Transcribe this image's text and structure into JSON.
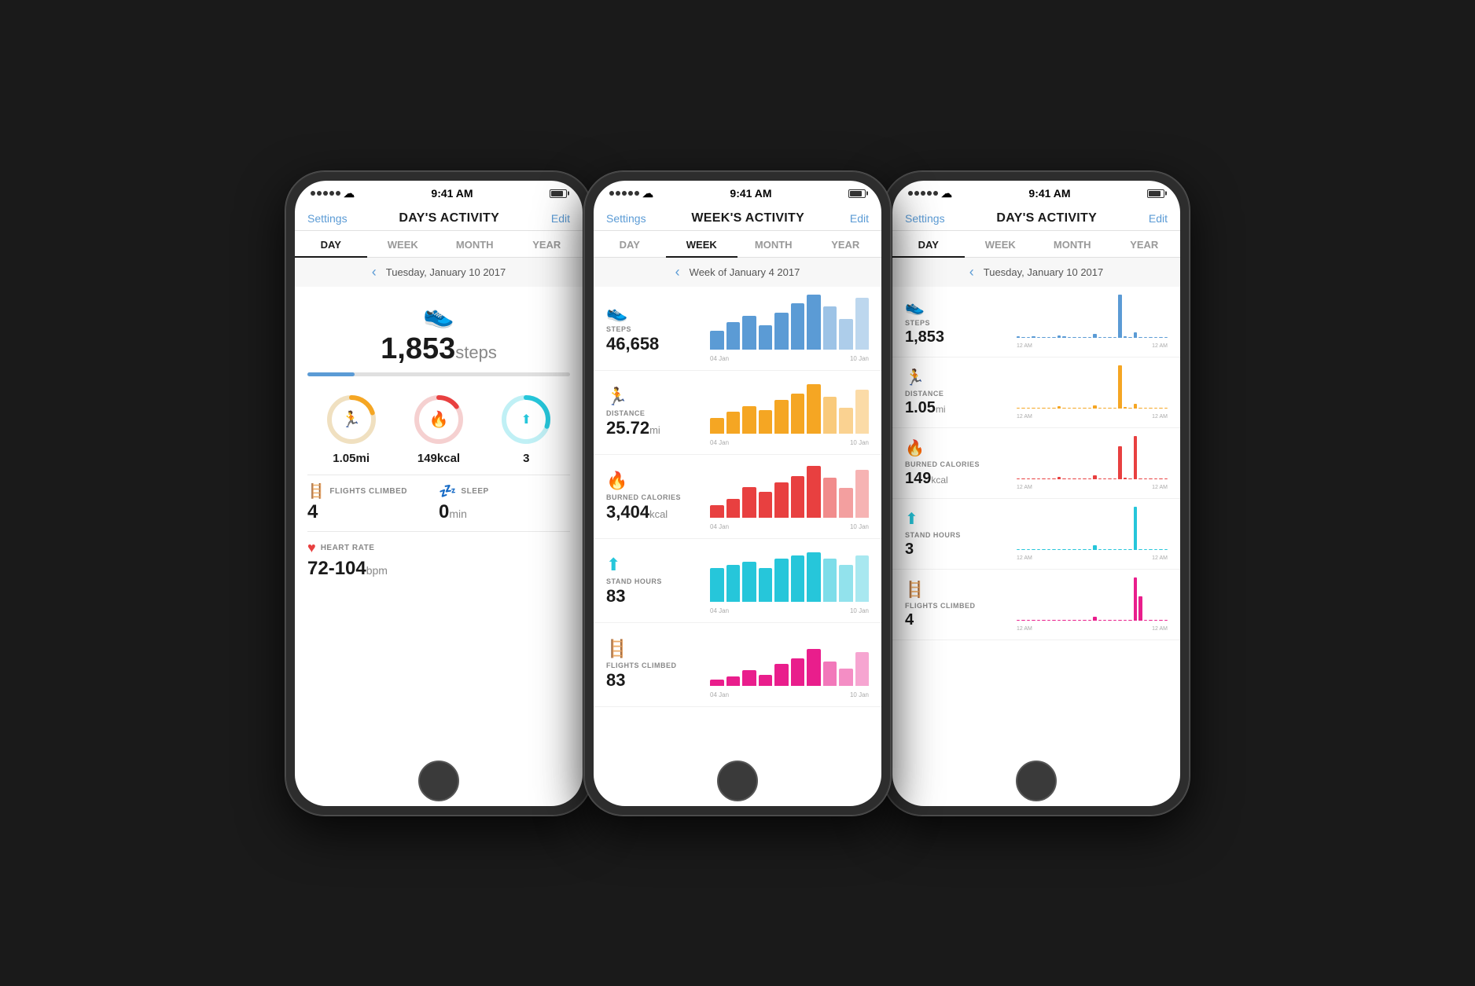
{
  "colors": {
    "blue": "#5b9bd5",
    "orange": "#f5a623",
    "red": "#e84040",
    "teal": "#26c6da",
    "purple": "#9c27b0",
    "pink": "#e91e8c",
    "green": "#4caf50"
  },
  "phone1": {
    "status": {
      "time": "9:41 AM",
      "signal": "●●●●●",
      "wifi": "WiFi"
    },
    "title": "DAY'S ACTIVITY",
    "nav_left": "Settings",
    "nav_right": "Edit",
    "tabs": [
      "DAY",
      "WEEK",
      "MONTH",
      "YEAR"
    ],
    "active_tab": "DAY",
    "date": "Tuesday, January 10 2017",
    "steps": "1,853",
    "steps_label": "steps",
    "progress_pct": 18,
    "rings": [
      {
        "label": "1.05mi",
        "icon": "🏃",
        "color": "#f5a623",
        "pct": 20
      },
      {
        "label": "149kcal",
        "icon": "🔥",
        "color": "#e84040",
        "pct": 15
      },
      {
        "label": "3",
        "icon": "⬆",
        "color": "#26c6da",
        "pct": 30
      }
    ],
    "metrics": [
      {
        "icon_color": "#9c27b0",
        "label": "FLIGHTS CLIMBED",
        "value": "4",
        "unit": ""
      },
      {
        "icon_color": "#5b9bd5",
        "label": "SLEEP",
        "value": "0",
        "unit": "min"
      },
      {
        "icon_color": "#e84040",
        "label": "HEART RATE",
        "value": "72-104",
        "unit": "bpm"
      }
    ]
  },
  "phone2": {
    "status": {
      "time": "9:41 AM"
    },
    "title": "WEEK'S ACTIVITY",
    "nav_left": "Settings",
    "nav_right": "Edit",
    "tabs": [
      "DAY",
      "WEEK",
      "MONTH",
      "YEAR"
    ],
    "active_tab": "WEEK",
    "date": "Week of January 4 2017",
    "date_start": "04 Jan",
    "date_end": "10 Jan",
    "rows": [
      {
        "icon": "👟",
        "label": "STEPS",
        "value": "46,658",
        "unit": "",
        "color": "#5b9bd5",
        "bars": [
          30,
          45,
          55,
          40,
          60,
          75,
          90,
          70,
          50,
          85
        ]
      },
      {
        "icon": "🏃",
        "label": "DISTANCE",
        "value": "25.72",
        "unit": "mi",
        "color": "#f5a623",
        "bars": [
          25,
          35,
          45,
          38,
          55,
          65,
          80,
          60,
          42,
          72
        ]
      },
      {
        "icon": "🔥",
        "label": "BURNED CALORIES",
        "value": "3,404",
        "unit": "kcal",
        "color": "#e84040",
        "bars": [
          20,
          30,
          50,
          42,
          58,
          68,
          85,
          65,
          48,
          78
        ]
      },
      {
        "icon": "⬆",
        "label": "STAND HOURS",
        "value": "83",
        "unit": "",
        "color": "#26c6da",
        "bars": [
          55,
          60,
          65,
          55,
          70,
          75,
          80,
          70,
          60,
          75
        ]
      },
      {
        "icon": "🪜",
        "label": "FLIGHTS CLIMBED",
        "value": "83",
        "unit": "",
        "color": "#e91e8c",
        "bars": [
          10,
          15,
          25,
          18,
          35,
          45,
          60,
          40,
          28,
          55
        ]
      }
    ]
  },
  "phone3": {
    "status": {
      "time": "9:41 AM"
    },
    "title": "DAY'S ACTIVITY",
    "nav_left": "Settings",
    "nav_right": "Edit",
    "tabs": [
      "DAY",
      "WEEK",
      "MONTH",
      "YEAR"
    ],
    "active_tab": "DAY",
    "date": "Tuesday, January 10 2017",
    "time_label_left": "12 AM",
    "time_label_right": "12 AM",
    "rows": [
      {
        "icon": "👟",
        "label": "STEPS",
        "value": "1,853",
        "unit": "",
        "color": "#5b9bd5",
        "bars": [
          0,
          0,
          0,
          0,
          0,
          0,
          0,
          0,
          2,
          0,
          0,
          0,
          0,
          0,
          0,
          4,
          0,
          0,
          0,
          0,
          0,
          0,
          0,
          0,
          0,
          0,
          0,
          80,
          0,
          0,
          0,
          8,
          0,
          0,
          0,
          0,
          0,
          0,
          0,
          0
        ]
      },
      {
        "icon": "🏃",
        "label": "DISTANCE",
        "value": "1.05",
        "unit": "mi",
        "color": "#f5a623",
        "bars": [
          0,
          0,
          0,
          0,
          0,
          0,
          0,
          0,
          1,
          0,
          0,
          0,
          0,
          0,
          0,
          2,
          0,
          0,
          0,
          0,
          0,
          0,
          0,
          0,
          0,
          0,
          0,
          70,
          0,
          0,
          0,
          5,
          0,
          0,
          0,
          0,
          0,
          0,
          0,
          0
        ]
      },
      {
        "icon": "🔥",
        "label": "BURNED CALORIES",
        "value": "149",
        "unit": "kcal",
        "color": "#e84040",
        "bars": [
          0,
          0,
          0,
          0,
          0,
          0,
          0,
          0,
          2,
          0,
          0,
          0,
          0,
          0,
          0,
          3,
          0,
          0,
          0,
          0,
          0,
          0,
          0,
          0,
          0,
          0,
          0,
          60,
          0,
          0,
          0,
          80,
          0,
          0,
          0,
          0,
          0,
          0,
          0,
          0
        ]
      },
      {
        "icon": "⬆",
        "label": "STAND HOURS",
        "value": "3",
        "unit": "",
        "color": "#26c6da",
        "bars": [
          0,
          0,
          0,
          0,
          0,
          0,
          0,
          0,
          0,
          0,
          0,
          0,
          0,
          0,
          0,
          5,
          0,
          0,
          0,
          0,
          0,
          0,
          0,
          0,
          0,
          0,
          0,
          0,
          0,
          0,
          0,
          70,
          0,
          0,
          0,
          0,
          0,
          0,
          0,
          0
        ]
      },
      {
        "icon": "🪜",
        "label": "FLIGHTS CLIMBED",
        "value": "4",
        "unit": "",
        "color": "#e91e8c",
        "bars": [
          0,
          0,
          0,
          0,
          0,
          0,
          0,
          0,
          0,
          0,
          0,
          0,
          0,
          0,
          0,
          4,
          0,
          0,
          0,
          0,
          0,
          0,
          0,
          0,
          0,
          0,
          0,
          0,
          0,
          0,
          0,
          60,
          0,
          0,
          0,
          0,
          0,
          0,
          0,
          0
        ]
      }
    ]
  }
}
